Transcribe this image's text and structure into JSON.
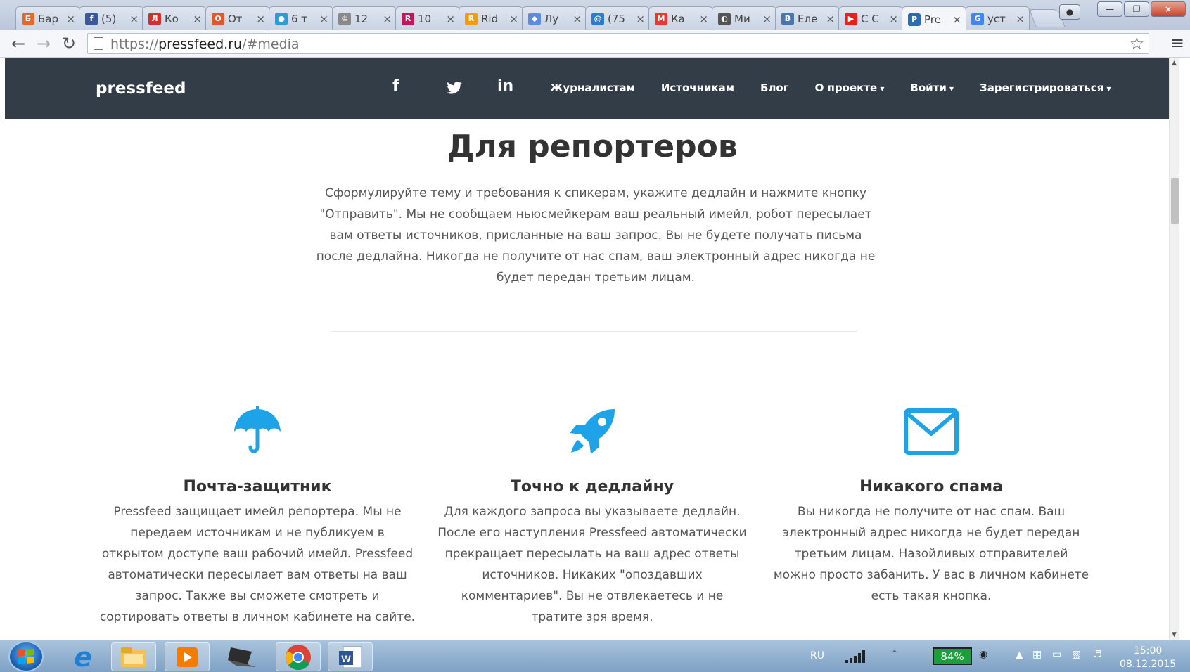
{
  "browser": {
    "tabs": [
      {
        "title": "Бар",
        "fav": "Б",
        "color": "#e06a2b"
      },
      {
        "title": "(5)",
        "fav": "f",
        "color": "#3b5998"
      },
      {
        "title": "Ко",
        "fav": "Л",
        "color": "#d32f2f"
      },
      {
        "title": "От",
        "fav": "О",
        "color": "#e4572e"
      },
      {
        "title": "6 т",
        "fav": "●",
        "color": "#2c9bd6"
      },
      {
        "title": "12",
        "fav": "♔",
        "color": "#8a8a8a"
      },
      {
        "title": "10",
        "fav": "R",
        "color": "#c2185b"
      },
      {
        "title": "Rid",
        "fav": "R",
        "color": "#f39c12"
      },
      {
        "title": "Лу",
        "fav": "◆",
        "color": "#5d8de0"
      },
      {
        "title": "(75",
        "fav": "@",
        "color": "#2e7bcf"
      },
      {
        "title": "Ка",
        "fav": "М",
        "color": "#e53935"
      },
      {
        "title": "Ми",
        "fav": "◐",
        "color": "#555555"
      },
      {
        "title": "Еле",
        "fav": "B",
        "color": "#4a76a8"
      },
      {
        "title": "С С",
        "fav": "▶",
        "color": "#e62117"
      },
      {
        "title": "Pre",
        "fav": "P",
        "color": "#2a6db5",
        "active": true
      },
      {
        "title": "уст",
        "fav": "G",
        "color": "#4285f4"
      }
    ],
    "url_scheme": "https://",
    "url_host": "pressfeed.ru",
    "url_path": "/#media",
    "close_glyph": "×"
  },
  "site": {
    "logo": "pressfeed",
    "social": {
      "facebook": "f",
      "twitter": "",
      "linkedin": "in"
    },
    "menu": [
      {
        "label": "Журналистам",
        "caret": false
      },
      {
        "label": "Источникам",
        "caret": false
      },
      {
        "label": "Блог",
        "caret": false
      },
      {
        "label": "О проекте",
        "caret": true
      },
      {
        "label": "Войти",
        "caret": true
      },
      {
        "label": "Зарегистрироваться",
        "caret": true
      }
    ]
  },
  "section": {
    "title": "Для репортеров",
    "lead": "Сформулируйте тему и требования к спикерам, укажите дедлайн и нажмите кнопку \"Отправить\". Мы не сообщаем ньюсмейкерам ваш реальный имейл, робот пересылает вам ответы источников, присланные на ваш запрос. Вы не будете получать письма после дедлайна. Никогда не получите от нас спам, ваш электронный адрес никогда не будет передан третьим лицам.",
    "accent": "#1fa3e8",
    "features": [
      {
        "icon": "umbrella-icon",
        "title": "Почта-защитник",
        "text": "Pressfeed защищает имейл репортера. Мы не передаем источникам и не публикуем в открытом доступе ваш рабочий имейл. Pressfeed автоматически пересылает вам ответы на ваш запрос. Также вы сможете смотреть и сортировать ответы в личном кабинете на сайте."
      },
      {
        "icon": "rocket-icon",
        "title": "Точно к дедлайну",
        "text": "Для каждого запроса вы указываете дедлайн. После его наступления Pressfeed автоматически прекращает пересылать на ваш адрес ответы источников. Никаких \"опоздавших комментариев\". Вы не отвлекаетесь и не тратите зря время."
      },
      {
        "icon": "envelope-icon",
        "title": "Никакого спама",
        "text": "Вы никогда не получите от нас спам. Ваш электронный адрес никогда не будет передан третьим лицам. Назойливых отправителей можно просто забанить. У вас в личном кабинете есть такая кнопка."
      }
    ]
  },
  "taskbar": {
    "language": "RU",
    "battery": "84%",
    "time": "15:00",
    "date": "08.12.2015"
  }
}
